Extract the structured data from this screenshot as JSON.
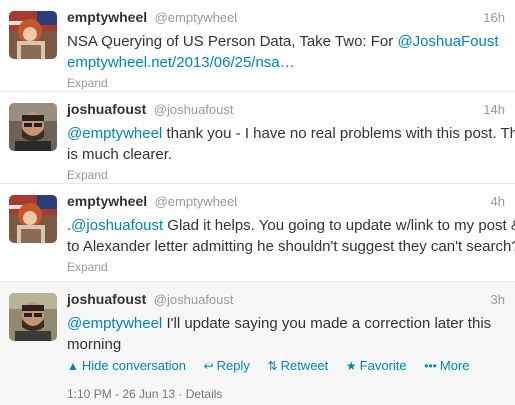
{
  "tweets": [
    {
      "fullname": "emptywheel",
      "username": "@emptywheel",
      "time": "16h",
      "text_plain_1": "NSA Querying of US Person Data, Take Two: For ",
      "text_link_1": "@JoshuaFoust",
      "text_link_2": "emptywheel.net/2013/06/25/nsa…",
      "expand": "Expand"
    },
    {
      "fullname": "joshuafoust",
      "username": "@joshuafoust",
      "time": "14h",
      "text_link_1": "@emptywheel",
      "text_plain_1": " thank you - I have no real problems with this post. This",
      "text_line_2": "is much clearer.",
      "expand": "Expand"
    },
    {
      "fullname": "emptywheel",
      "username": "@emptywheel",
      "time": "4h",
      "text_prefix": ".",
      "text_link_1": "@joshuafoust",
      "text_plain_1": " Glad it helps. You going to update w/link to my post &",
      "text_line_2": "to Alexander letter admitting he shouldn't suggest they can't search?",
      "expand": "Expand"
    },
    {
      "fullname": "joshuafoust",
      "username": "@joshuafoust",
      "time": "3h",
      "text_link_1": "@emptywheel",
      "text_plain_1": " I'll update saying you made a correction later this",
      "text_line_2": "morning",
      "actions": {
        "hide": "Hide conversation",
        "reply": "Reply",
        "retweet": "Retweet",
        "favorite": "Favorite",
        "more": "More"
      },
      "meta": "1:10 PM - 26 Jun 13 · Details"
    }
  ],
  "icons": {
    "hide": "chevron-up-icon",
    "reply": "reply-arrow-icon",
    "retweet": "retweet-icon",
    "favorite": "star-icon",
    "more": "more-dots-icon"
  },
  "colors": {
    "link": "#0084b4",
    "secondary_text": "#999999",
    "expanded_background": "#f7f7f7"
  }
}
